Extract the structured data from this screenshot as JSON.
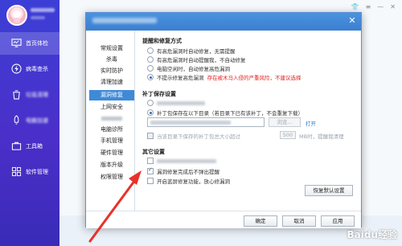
{
  "app": {
    "sidebar": {
      "items": [
        {
          "label": "首页体检",
          "icon": "monitor-icon",
          "active": true
        },
        {
          "label": "病毒查杀",
          "icon": "lightning-icon",
          "active": false
        },
        {
          "label": "垃圾清理",
          "icon": "broom-icon",
          "active": false
        },
        {
          "label": "电脑加速",
          "icon": "rocket-icon",
          "active": false
        },
        {
          "label": "工具箱",
          "icon": "toolbox-icon",
          "active": false
        },
        {
          "label": "软件管理",
          "icon": "apps-icon",
          "active": false
        }
      ]
    },
    "accent_color": "#3b3fd6"
  },
  "dialog": {
    "nav": {
      "items": [
        {
          "label": "常规设置",
          "active": false
        },
        {
          "label": "杀毒",
          "active": false
        },
        {
          "label": "实时防护",
          "active": false
        },
        {
          "label": "清理加速",
          "active": false
        },
        {
          "label": "漏洞修复",
          "active": true
        },
        {
          "label": "上网安全",
          "active": false
        },
        {
          "label": "",
          "active": false
        },
        {
          "label": "电脑诊所",
          "active": false
        },
        {
          "label": "手机管理",
          "active": false
        },
        {
          "label": "硬件管理",
          "active": false
        },
        {
          "label": "版本升级",
          "active": false
        },
        {
          "label": "权限管理",
          "active": false
        }
      ]
    },
    "repair_mode": {
      "title": "提醒和修复方式",
      "options": [
        {
          "label": "有高危漏洞时自动修复，无需提醒",
          "selected": false
        },
        {
          "label": "有高危漏洞时自动提醒我，不自动修复",
          "selected": false
        },
        {
          "label": "电脑空闲时，自动修复高危漏洞",
          "selected": false
        },
        {
          "label": "不提示修复高危漏洞",
          "selected": true,
          "warning": "存在被木马入侵的严重风险，不建议选择"
        }
      ]
    },
    "patch_save": {
      "title": "补丁保存设置",
      "option_selected_label": "补丁包保存在以下目录（若目录下已有该补丁，不会重复下载）",
      "browse_label": "浏览...",
      "open_label": "打开",
      "size_prefix": "当该目录下保存的补丁包总大小超过",
      "size_value": "500",
      "size_suffix": "MB时，提醒我清理"
    },
    "other": {
      "title": "其它设置",
      "checkbox_1_checked": false,
      "checkbox_2_label": "漏洞修复完成后不弹出提醒",
      "checkbox_2_checked": true,
      "checkbox_3_label": "开启蓝屏修复功能，放心修漏洞",
      "checkbox_3_checked": false,
      "restore_label": "恢复默认设置"
    },
    "footer": {
      "ok_label": "确定",
      "cancel_label": "取消",
      "apply_label": "应用"
    }
  },
  "watermark": "Baidu经验"
}
